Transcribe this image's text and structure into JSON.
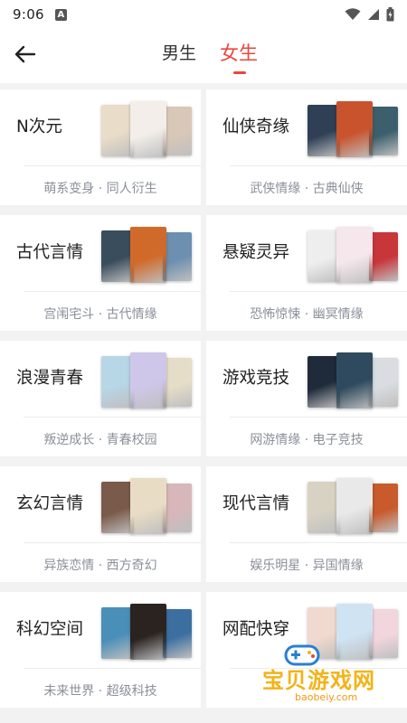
{
  "status": {
    "time": "9:06",
    "notify_badge": "A"
  },
  "header": {
    "tabs": [
      {
        "label": "男生"
      },
      {
        "label": "女生"
      }
    ]
  },
  "cards": [
    {
      "title": "N次元",
      "subtitle": "萌系变身 · 同人衍生",
      "cover_colors": [
        "#e9dcc9",
        "#f3eee9",
        "#d9c8b8"
      ]
    },
    {
      "title": "仙侠奇缘",
      "subtitle": "武侠情缘 · 古典仙侠",
      "cover_colors": [
        "#2e3f56",
        "#c9532c",
        "#3b5f6c"
      ]
    },
    {
      "title": "古代言情",
      "subtitle": "宫闱宅斗 · 古代情缘",
      "cover_colors": [
        "#3a4d5c",
        "#d06a2a",
        "#6d8fb0"
      ]
    },
    {
      "title": "悬疑灵异",
      "subtitle": "恐怖惊悚 · 幽冥情缘",
      "cover_colors": [
        "#eeeeee",
        "#f5e7ec",
        "#c8363a"
      ]
    },
    {
      "title": "浪漫青春",
      "subtitle": "叛逆成长 · 青春校园",
      "cover_colors": [
        "#b7d6e6",
        "#cfc7ea",
        "#e6ddc8"
      ]
    },
    {
      "title": "游戏竞技",
      "subtitle": "网游情缘 · 电子竞技",
      "cover_colors": [
        "#1f2b3a",
        "#2f4a5e",
        "#d9dde2"
      ]
    },
    {
      "title": "玄幻言情",
      "subtitle": "异族恋情 · 西方奇幻",
      "cover_colors": [
        "#7a5a4a",
        "#e8dcc4",
        "#d7b7b9"
      ]
    },
    {
      "title": "现代言情",
      "subtitle": "娱乐明星 · 异国情缘",
      "cover_colors": [
        "#d8d2c2",
        "#e9e9e9",
        "#c85a2c"
      ]
    },
    {
      "title": "科幻空间",
      "subtitle": "未来世界 · 超级科技",
      "cover_colors": [
        "#4a8fb8",
        "#2a2320",
        "#3c6fa0"
      ]
    },
    {
      "title": "网配快穿",
      "subtitle": "",
      "cover_colors": [
        "#f0d9cf",
        "#cfe3f2",
        "#f2d6de"
      ]
    }
  ],
  "watermark": {
    "text": "宝贝游戏网",
    "url": "baobeiy.com",
    "color": "#f3b319"
  },
  "colors": {
    "accent": "#e8473b",
    "subtitle": "#8a8f99",
    "background": "#f2f2f2"
  }
}
